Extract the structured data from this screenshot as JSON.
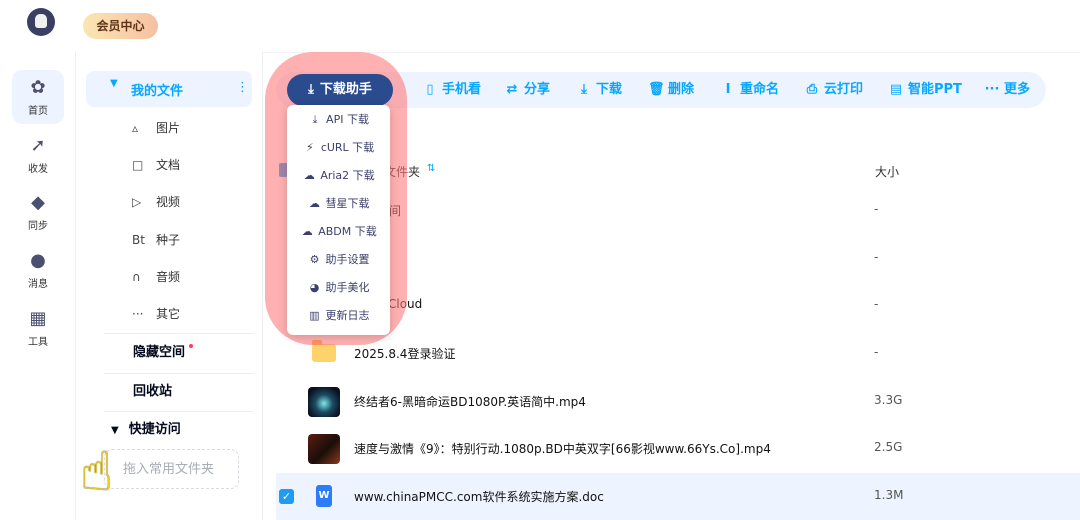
{
  "top": {
    "vip_label": "会员中心"
  },
  "leftnav": {
    "items": [
      {
        "label": "首页",
        "icon": "home-icon"
      },
      {
        "label": "收发",
        "icon": "transfer-icon"
      },
      {
        "label": "同步",
        "icon": "sync-icon"
      },
      {
        "label": "消息",
        "icon": "message-icon"
      },
      {
        "label": "工具",
        "icon": "tools-icon"
      }
    ]
  },
  "sidebar": {
    "my_files": "我的文件",
    "categories": [
      {
        "icon_text": "▵",
        "label": "图片"
      },
      {
        "icon_text": "□",
        "label": "文档"
      },
      {
        "icon_text": "▷",
        "label": "视频"
      },
      {
        "icon_text": "Bt",
        "label": "种子"
      },
      {
        "icon_text": "∩",
        "label": "音频"
      },
      {
        "icon_text": "···",
        "label": "其它"
      }
    ],
    "hidden_space": "隐藏空间",
    "recycle_bin": "回收站",
    "quick_access": "快捷访问",
    "quick_access_hint": "拖入常用文件夹"
  },
  "toolbar": {
    "download_helper": "下载助手",
    "buttons": [
      {
        "label": "手机看",
        "icon": "phone-icon"
      },
      {
        "label": "分享",
        "icon": "share-icon"
      },
      {
        "label": "下载",
        "icon": "download-icon"
      },
      {
        "label": "删除",
        "icon": "trash-icon"
      },
      {
        "label": "重命名",
        "icon": "rename-icon"
      },
      {
        "label": "云打印",
        "icon": "print-icon"
      },
      {
        "label": "智能PPT",
        "icon": "ppt-icon"
      },
      {
        "label": "更多",
        "icon": "more-icon"
      }
    ]
  },
  "dropdown": {
    "items": [
      {
        "label": "API 下载",
        "icon": "download-icon"
      },
      {
        "label": "cURL 下载",
        "icon": "plug-icon"
      },
      {
        "label": "Aria2 下载",
        "icon": "cloud-download-icon"
      },
      {
        "label": "彗星下载",
        "icon": "cloud-download-icon"
      },
      {
        "label": "ABDM 下载",
        "icon": "cloud-download-icon"
      },
      {
        "label": "助手设置",
        "icon": "settings-icon"
      },
      {
        "label": "助手美化",
        "icon": "palette-icon"
      },
      {
        "label": "更新日志",
        "icon": "log-icon"
      }
    ]
  },
  "table": {
    "header_name": "文件夹",
    "header_size": "大小",
    "rows": [
      {
        "name_visible": "间",
        "size": "-"
      },
      {
        "name_visible": "",
        "size": "-"
      },
      {
        "name_visible": "Cloud",
        "size": "-"
      },
      {
        "name_visible": "2025.8.4登录验证",
        "size": "-"
      },
      {
        "name_visible": "终结者6-黑暗命运BD1080P.英语简中.mp4",
        "size": "3.3G"
      },
      {
        "name_visible": "速度与激情《9》：特别行动.1080p.BD中英双字[66影视www.66Ys.Co].mp4",
        "size": "2.5G"
      },
      {
        "name_visible": "www.chinaPMCC.com软件系统实施方案.doc",
        "size": "1.3M"
      }
    ]
  }
}
